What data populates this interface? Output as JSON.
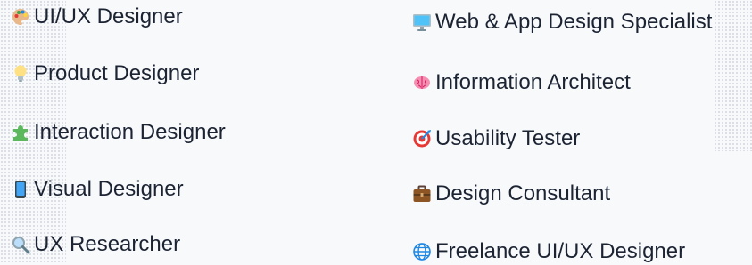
{
  "left_column": [
    {
      "label": "UI/UX Designer",
      "icon": "palette-icon"
    },
    {
      "label": "Product Designer",
      "icon": "light-bulb-icon"
    },
    {
      "label": "Interaction Designer",
      "icon": "puzzle-piece-icon"
    },
    {
      "label": "Visual Designer",
      "icon": "mobile-phone-icon"
    },
    {
      "label": "UX Researcher",
      "icon": "magnifying-glass-icon"
    }
  ],
  "right_column": [
    {
      "label": "Web & App Design Specialist",
      "icon": "desktop-computer-icon"
    },
    {
      "label": "Information Architect",
      "icon": "brain-icon"
    },
    {
      "label": "Usability Tester",
      "icon": "direct-hit-target-icon"
    },
    {
      "label": "Design Consultant",
      "icon": "briefcase-icon"
    },
    {
      "label": "Freelance UI/UX Designer",
      "icon": "globe-icon"
    }
  ],
  "colors": {
    "text": "#1c2433",
    "background": "#f8f9fb"
  }
}
